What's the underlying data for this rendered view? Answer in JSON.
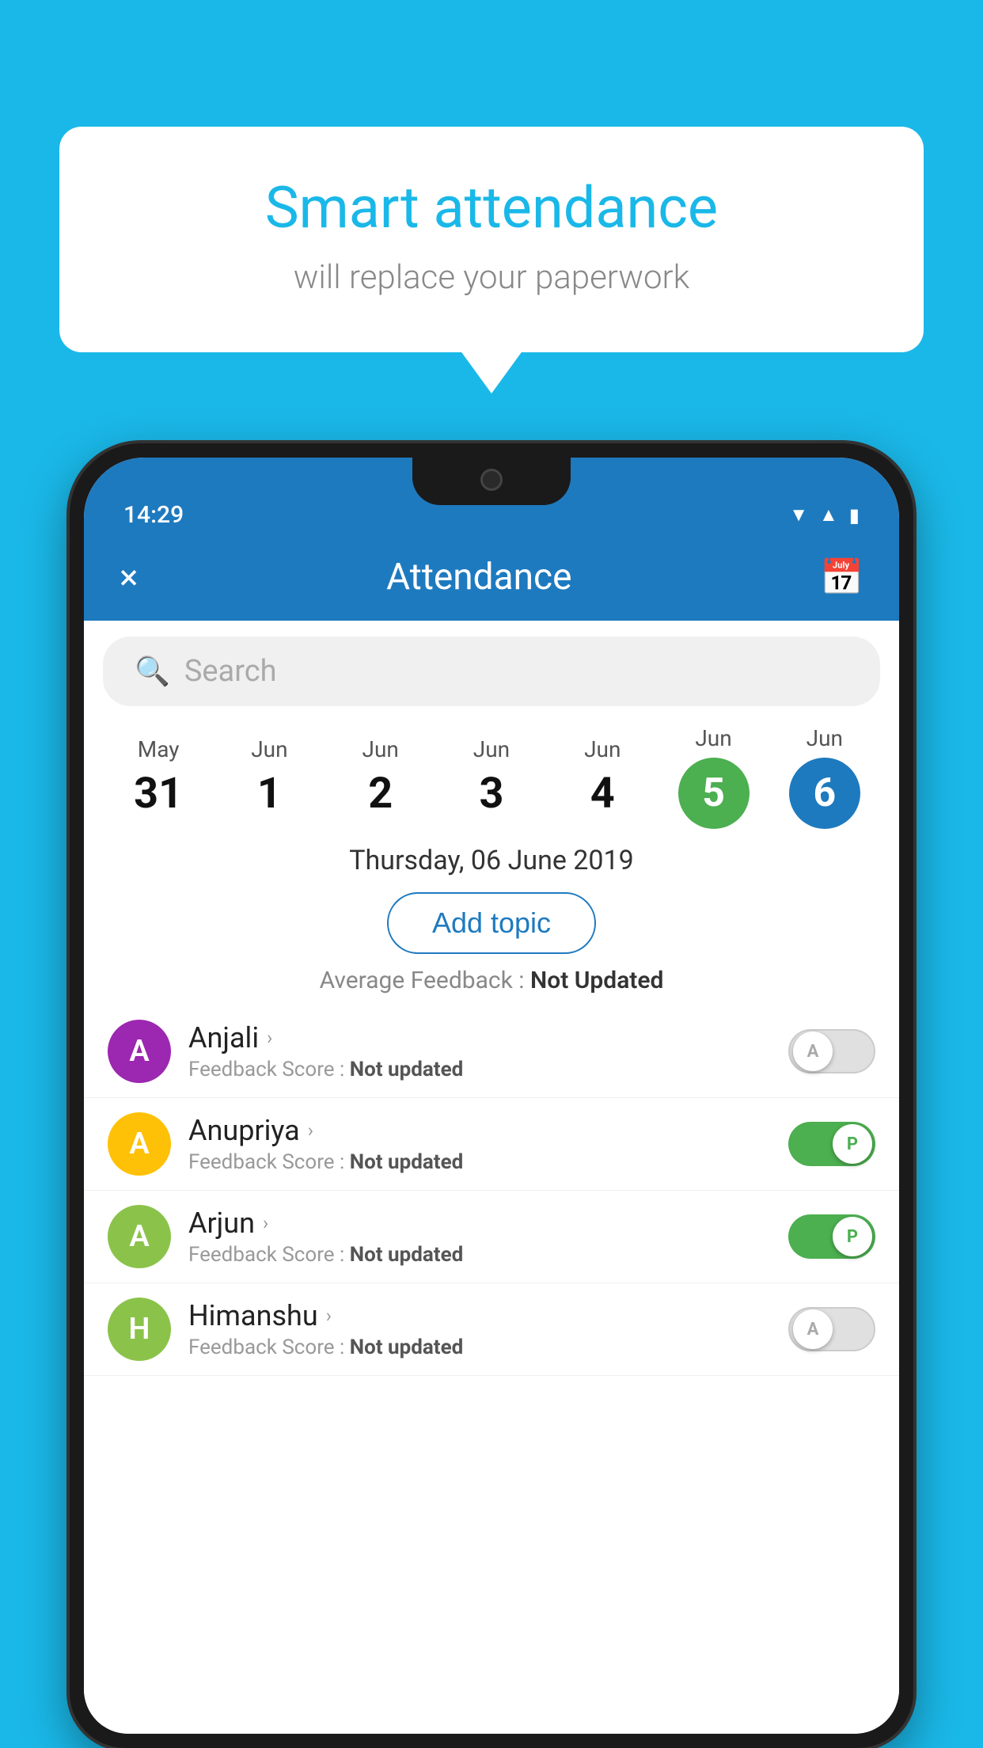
{
  "background_color": "#1ab8e8",
  "bubble": {
    "title": "Smart attendance",
    "subtitle": "will replace your paperwork"
  },
  "phone": {
    "status_bar": {
      "time": "14:29",
      "icons": [
        "wifi",
        "signal",
        "battery"
      ]
    },
    "app_bar": {
      "title": "Attendance",
      "close_label": "×",
      "calendar_label": "📅"
    },
    "search": {
      "placeholder": "Search"
    },
    "calendar": {
      "days": [
        {
          "month": "May",
          "day": "31",
          "active": false
        },
        {
          "month": "Jun",
          "day": "1",
          "active": false
        },
        {
          "month": "Jun",
          "day": "2",
          "active": false
        },
        {
          "month": "Jun",
          "day": "3",
          "active": false
        },
        {
          "month": "Jun",
          "day": "4",
          "active": false
        },
        {
          "month": "Jun",
          "day": "5",
          "active": "green"
        },
        {
          "month": "Jun",
          "day": "6",
          "active": "blue"
        }
      ]
    },
    "selected_date": "Thursday, 06 June 2019",
    "add_topic_label": "Add topic",
    "avg_feedback_label": "Average Feedback : ",
    "avg_feedback_value": "Not Updated",
    "students": [
      {
        "name": "Anjali",
        "avatar_letter": "A",
        "avatar_color": "#9c27b0",
        "feedback": "Not updated",
        "toggle_state": "off",
        "toggle_letter": "A"
      },
      {
        "name": "Anupriya",
        "avatar_letter": "A",
        "avatar_color": "#ffc107",
        "feedback": "Not updated",
        "toggle_state": "on",
        "toggle_letter": "P"
      },
      {
        "name": "Arjun",
        "avatar_letter": "A",
        "avatar_color": "#8bc34a",
        "feedback": "Not updated",
        "toggle_state": "on",
        "toggle_letter": "P"
      },
      {
        "name": "Himanshu",
        "avatar_letter": "H",
        "avatar_color": "#8bc34a",
        "feedback": "Not updated",
        "toggle_state": "off",
        "toggle_letter": "A"
      }
    ]
  }
}
